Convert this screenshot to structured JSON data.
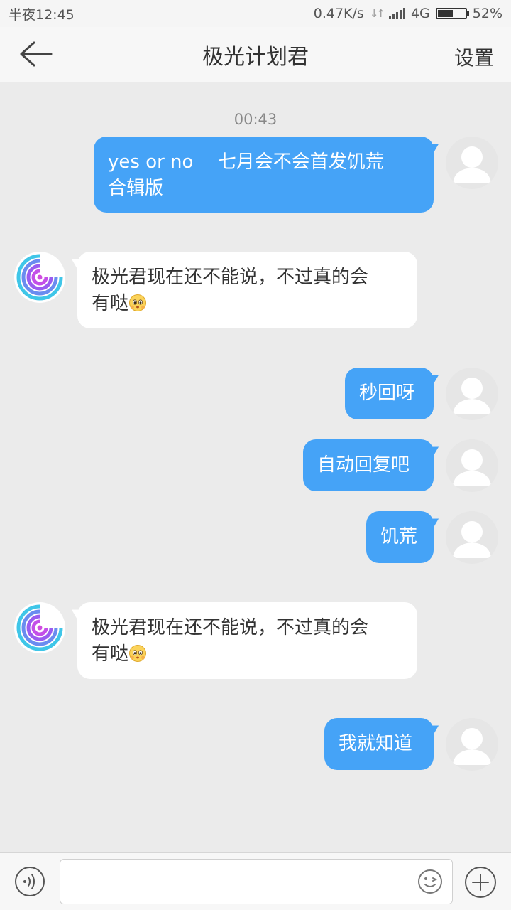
{
  "status_bar": {
    "time": "半夜12:45",
    "speed": "0.47K/s",
    "network": "4G",
    "battery": "52%"
  },
  "header": {
    "title": "极光计划君",
    "action_label": "设置"
  },
  "chat": {
    "timestamp": "00:43",
    "messages": [
      {
        "from": "user",
        "text_line1": "yes or no　 七月会不会首发饥荒",
        "text_line2": "合辑版"
      },
      {
        "from": "bot",
        "text_line1": "极光君现在还不能说，不过真的会",
        "text_line2": "有哒"
      },
      {
        "from": "user",
        "text": "秒回呀"
      },
      {
        "from": "user",
        "text": "自动回复吧"
      },
      {
        "from": "user",
        "text": "饥荒"
      },
      {
        "from": "bot",
        "text_line1": "极光君现在还不能说，不过真的会",
        "text_line2": "有哒"
      },
      {
        "from": "user",
        "text": "我就知道"
      }
    ]
  },
  "input_bar": {
    "placeholder": ""
  },
  "colors": {
    "outgoing_bubble": "#45a3f7",
    "incoming_bubble": "#ffffff",
    "background": "#ebebeb"
  },
  "icons": {
    "back": "back-arrow-icon",
    "voice": "voice-icon",
    "emoji": "smiley-icon",
    "plus": "plus-icon"
  }
}
